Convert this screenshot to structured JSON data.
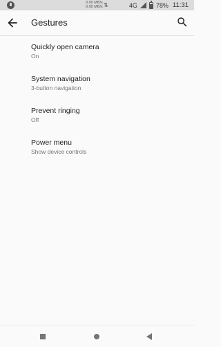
{
  "status_bar": {
    "net_up": "0.00 MB/s",
    "net_down": "0.00 MB/s",
    "network": "4G",
    "battery": "78%",
    "time": "11:31"
  },
  "app_bar": {
    "title": "Gestures"
  },
  "items": [
    {
      "title": "Quickly open camera",
      "subtitle": "On"
    },
    {
      "title": "System navigation",
      "subtitle": "3-button navigation"
    },
    {
      "title": "Prevent ringing",
      "subtitle": "Off"
    },
    {
      "title": "Power menu",
      "subtitle": "Show device controls"
    }
  ],
  "icons": {
    "back": "back-arrow-icon",
    "search": "search-icon",
    "recents": "recents-icon",
    "home": "home-icon",
    "nav_back": "nav-back-icon"
  }
}
